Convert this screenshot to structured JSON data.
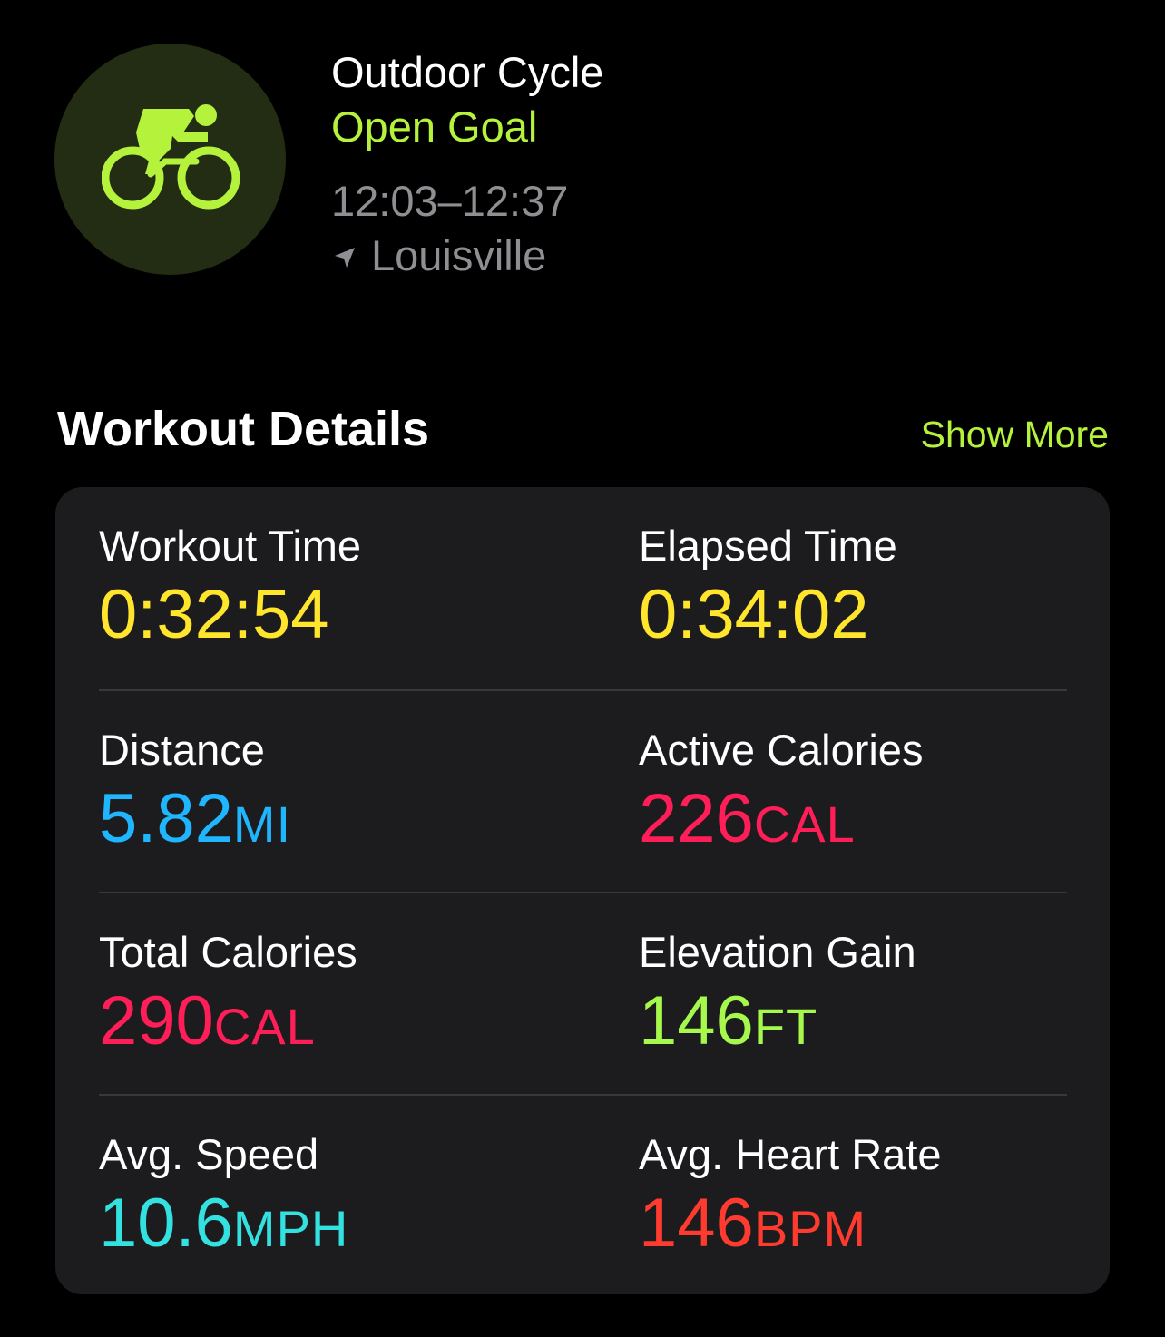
{
  "header": {
    "activity_icon": "bicycle-rider-icon",
    "workout_name": "Outdoor Cycle",
    "goal": "Open Goal",
    "time_range": "12:03–12:37",
    "location_icon": "location-arrow-icon",
    "location": "Louisville"
  },
  "details": {
    "title": "Workout Details",
    "show_more_label": "Show More",
    "metrics": [
      {
        "label": "Workout Time",
        "value": "0:32:54",
        "unit": "",
        "color": "#ffe52b"
      },
      {
        "label": "Elapsed Time",
        "value": "0:34:02",
        "unit": "",
        "color": "#ffe52b"
      },
      {
        "label": "Distance",
        "value": "5.82",
        "unit": "MI",
        "color": "#1fb6ff"
      },
      {
        "label": "Active Calories",
        "value": "226",
        "unit": "CAL",
        "color": "#ff1e57"
      },
      {
        "label": "Total Calories",
        "value": "290",
        "unit": "CAL",
        "color": "#ff1e57"
      },
      {
        "label": "Elevation Gain",
        "value": "146",
        "unit": "FT",
        "color": "#a6f84c"
      },
      {
        "label": "Avg. Speed",
        "value": "10.6",
        "unit": "MPH",
        "color": "#33e2e0"
      },
      {
        "label": "Avg. Heart Rate",
        "value": "146",
        "unit": "BPM",
        "color": "#ff3b2f"
      }
    ]
  },
  "colors": {
    "background": "#000000",
    "card": "#1c1c1e",
    "accent": "#b5f23c",
    "secondary_text": "#8e8e93",
    "badge": "#222d14"
  }
}
